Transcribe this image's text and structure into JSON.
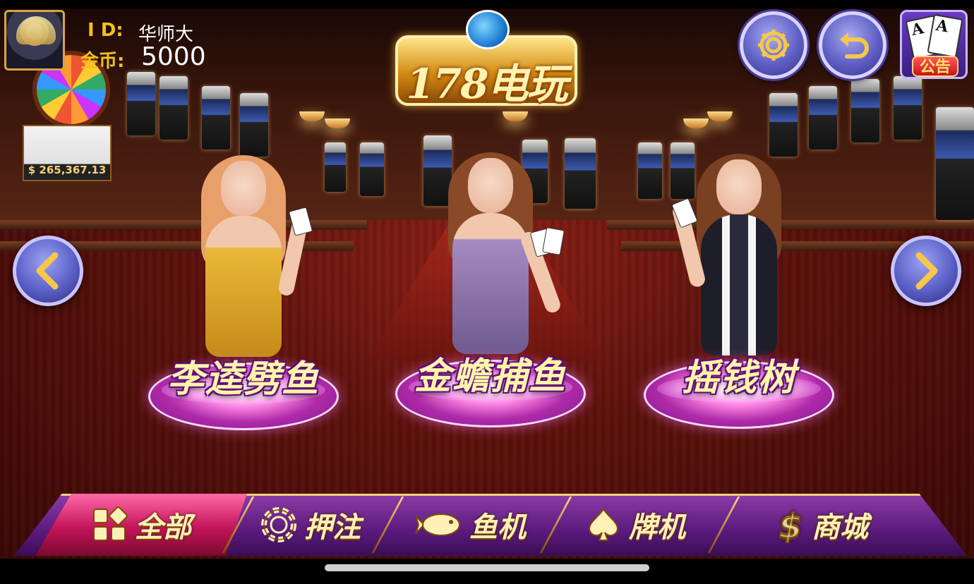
{
  "header": {
    "id_label": "I D:",
    "id_value": "华师大",
    "coin_label": "金币:",
    "coin_value": "5000"
  },
  "logo": {
    "text": "178电玩"
  },
  "buttons": {
    "settings_icon": "gear-icon",
    "back_icon": "return-arrow-icon",
    "notice_label": "公告",
    "notice_cards": [
      "A",
      "A"
    ]
  },
  "background": {
    "jackpot_text": "$ 265,367.13"
  },
  "games": [
    {
      "title": "李逵劈鱼",
      "hair": "#e8a06a",
      "dress": "#e9b93a"
    },
    {
      "title": "金蟾捕鱼",
      "hair": "#8a4a28",
      "dress": "#a68ac0"
    },
    {
      "title": "摇钱树",
      "hair": "#7a4022",
      "dress": "#1e1e2a"
    }
  ],
  "nav": {
    "tabs": [
      {
        "label": "全部",
        "icon": "grid-icon",
        "active": true
      },
      {
        "label": "押注",
        "icon": "chip-icon",
        "active": false
      },
      {
        "label": "鱼机",
        "icon": "fish-icon",
        "active": false
      },
      {
        "label": "牌机",
        "icon": "spade-icon",
        "active": false
      },
      {
        "label": "商城",
        "icon": "dollar-icon",
        "active": false
      }
    ]
  },
  "colors": {
    "accent_gold": "#f2c21b",
    "nav_purple": "#5a1a7c",
    "active_tab": "#c4145a"
  }
}
